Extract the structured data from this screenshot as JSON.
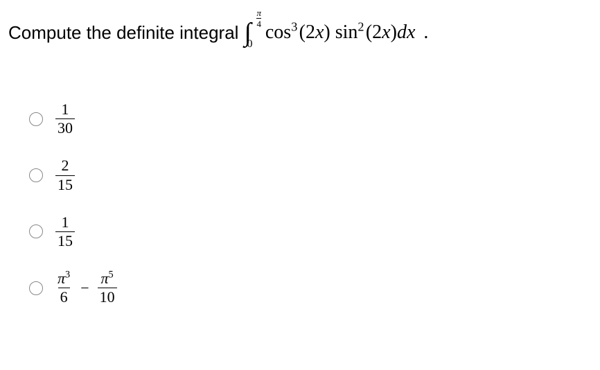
{
  "question": {
    "prompt": "Compute the definite integral",
    "integral": {
      "symbol": "∫",
      "upper_num": "π",
      "upper_den": "4",
      "lower": "0",
      "cos_label": "cos",
      "cos_power": "3",
      "arg1_coef": "2",
      "arg1_var": "x",
      "sin_label": "sin",
      "sin_power": "2",
      "arg2_coef": "2",
      "arg2_var": "x",
      "dvar_d": "d",
      "dvar_x": "x",
      "period": "."
    }
  },
  "options": {
    "a": {
      "num": "1",
      "den": "30"
    },
    "b": {
      "num": "2",
      "den": "15"
    },
    "c": {
      "num": "1",
      "den": "15"
    },
    "d": {
      "frac1_num_pi": "π",
      "frac1_num_exp": "3",
      "frac1_den": "6",
      "minus": "−",
      "frac2_num_pi": "π",
      "frac2_num_exp": "5",
      "frac2_den": "10"
    }
  }
}
